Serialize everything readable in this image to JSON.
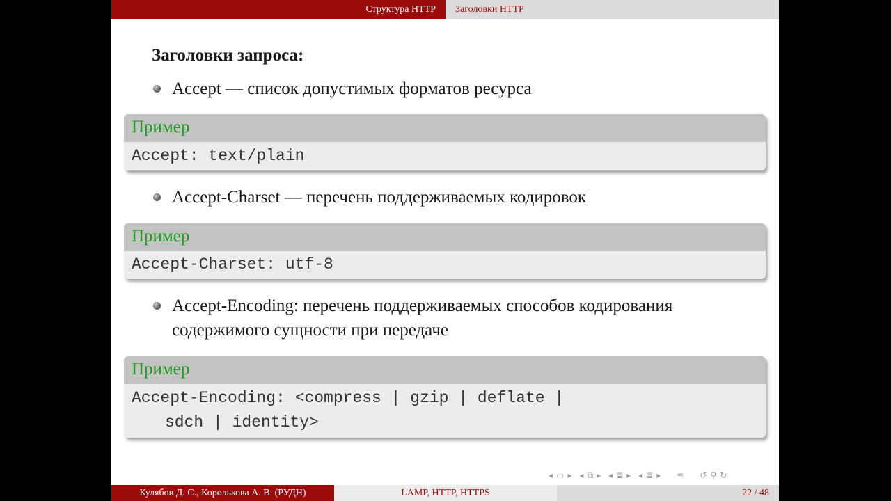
{
  "header": {
    "section": "Структура HTTP",
    "subsection": "Заголовки HTTP"
  },
  "content": {
    "heading": "Заголовки запроса:",
    "items": [
      {
        "bullet": "Accept — список допустимых форматов ресурса",
        "example_title": "Пример",
        "example_lines": [
          "Accept: text/plain"
        ]
      },
      {
        "bullet": "Accept-Charset — перечень поддерживаемых кодировок",
        "example_title": "Пример",
        "example_lines": [
          "Accept-Charset: utf-8"
        ]
      },
      {
        "bullet_lines": [
          "Accept-Encoding: перечень поддерживаемых способов кодирования",
          "содержимого сущности при передаче"
        ],
        "example_title": "Пример",
        "example_lines": [
          "Accept-Encoding: <compress | gzip | deflate |",
          "sdch | identity>"
        ]
      }
    ]
  },
  "navigation": {
    "icons": [
      "nav-first-arrow",
      "frame-icon",
      "nav-next-arrow",
      "nav-prev-arrow",
      "subsection-icon",
      "nav-next-arrow",
      "nav-prev-arrow",
      "section-icon",
      "nav-next-arrow",
      "nav-prev-arrow",
      "slide-icon",
      "nav-next-arrow",
      "menu-icon",
      "back-icon",
      "search-icon",
      "forward-icon"
    ]
  },
  "footer": {
    "authors": "Кулябов Д. С., Королькова А. В.  (РУДН)",
    "title": "LAMP, HTTP, HTTPS",
    "page": "22 / 48"
  },
  "colors": {
    "accent": "#9b0b0b",
    "example_title": "#1d9b1d",
    "block_title_bg": "#c3c3c3",
    "block_body_bg": "#ececec"
  }
}
